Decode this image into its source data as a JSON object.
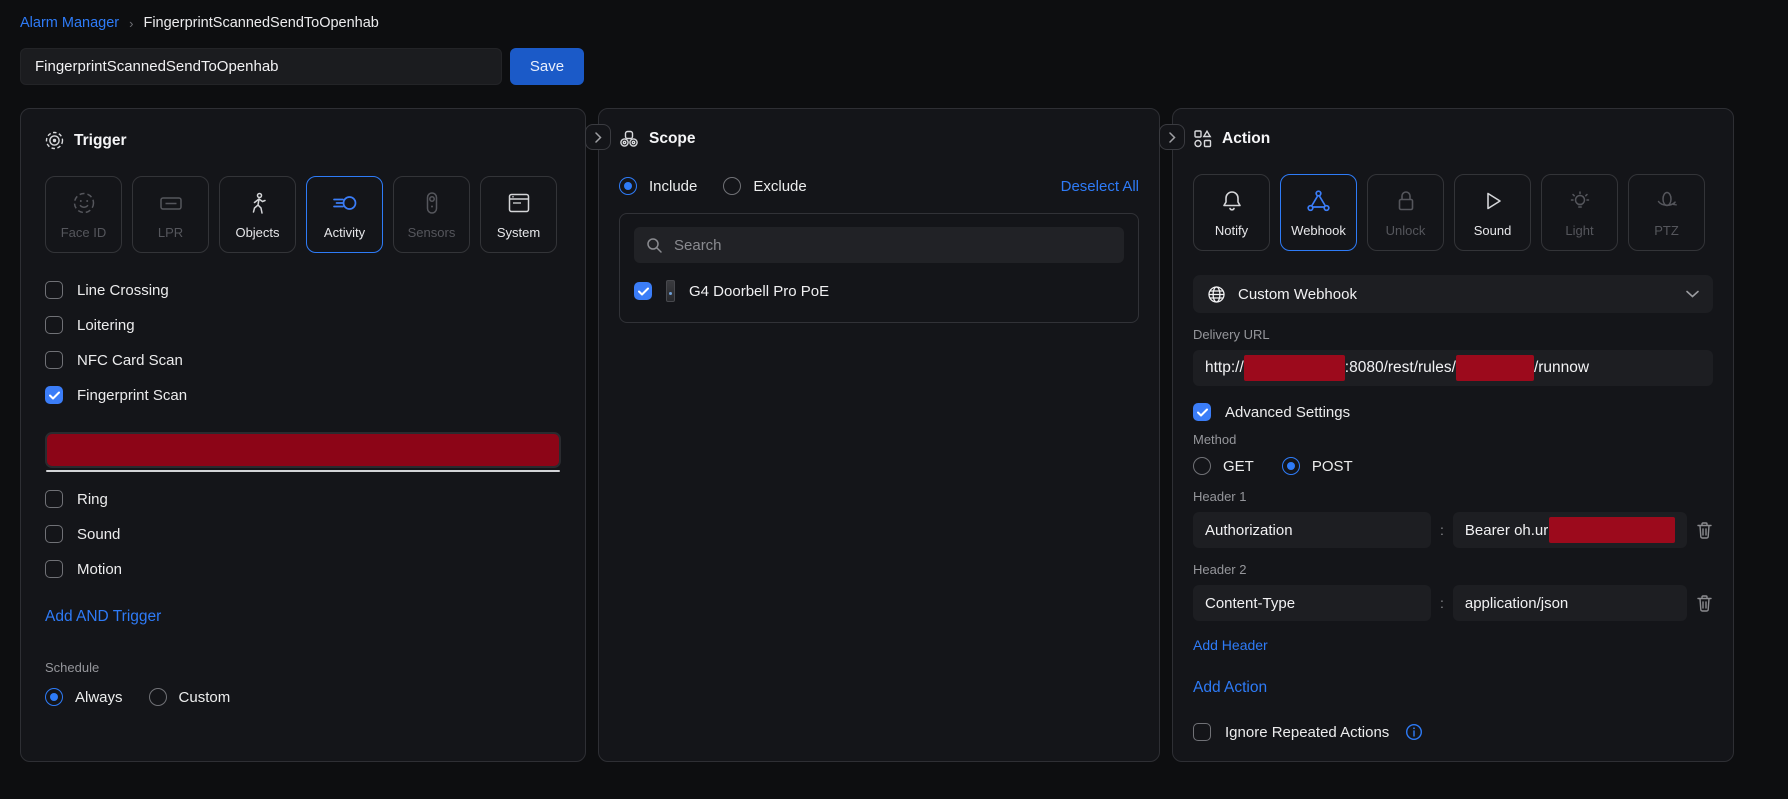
{
  "breadcrumb": {
    "parent": "Alarm Manager",
    "divider": "›",
    "current": "FingerprintScannedSendToOpenhab"
  },
  "name_field": {
    "value": "FingerprintScannedSendToOpenhab"
  },
  "save_label": "Save",
  "colors": {
    "accent_blue": "#2e7bf7",
    "save_button": "#1b5ac8",
    "checkbox_blue": "#3b7df8",
    "redaction_dark_red": "#8c0517",
    "redaction_red": "#9c0a1c",
    "panel_bg": "#141519",
    "page_bg": "#0d0e10"
  },
  "trigger": {
    "title": "Trigger",
    "types": [
      {
        "label": "Face ID",
        "state": "disabled"
      },
      {
        "label": "LPR",
        "state": "disabled"
      },
      {
        "label": "Objects",
        "state": "normal"
      },
      {
        "label": "Activity",
        "state": "selected"
      },
      {
        "label": "Sensors",
        "state": "disabled"
      },
      {
        "label": "System",
        "state": "normal"
      }
    ],
    "events": [
      {
        "label": "Line Crossing",
        "checked": false
      },
      {
        "label": "Loitering",
        "checked": false
      },
      {
        "label": "NFC Card Scan",
        "checked": false
      },
      {
        "label": "Fingerprint Scan",
        "checked": true
      },
      {
        "label": "Ring",
        "checked": false
      },
      {
        "label": "Sound",
        "checked": false
      },
      {
        "label": "Motion",
        "checked": false
      }
    ],
    "add_and_trigger": "Add AND Trigger",
    "schedule_label": "Schedule",
    "schedule_options": [
      {
        "label": "Always",
        "selected": true
      },
      {
        "label": "Custom",
        "selected": false
      }
    ]
  },
  "scope": {
    "title": "Scope",
    "mode_options": [
      {
        "label": "Include",
        "selected": true
      },
      {
        "label": "Exclude",
        "selected": false
      }
    ],
    "deselect_all": "Deselect All",
    "search_placeholder": "Search",
    "devices": [
      {
        "label": "G4 Doorbell Pro PoE",
        "checked": true
      }
    ]
  },
  "action": {
    "title": "Action",
    "types": [
      {
        "label": "Notify",
        "state": "normal"
      },
      {
        "label": "Webhook",
        "state": "selected"
      },
      {
        "label": "Unlock",
        "state": "disabled"
      },
      {
        "label": "Sound",
        "state": "normal"
      },
      {
        "label": "Light",
        "state": "disabled"
      },
      {
        "label": "PTZ",
        "state": "disabled"
      }
    ],
    "webhook_select": "Custom Webhook",
    "delivery_url_label": "Delivery URL",
    "delivery_url": {
      "prefix": "http://",
      "mid": ":8080/rest/rules/",
      "suffix": "/runnow"
    },
    "advanced_settings": "Advanced Settings",
    "method_label": "Method",
    "method_options": [
      {
        "label": "GET",
        "selected": false
      },
      {
        "label": "POST",
        "selected": true
      }
    ],
    "separator": ":",
    "headers": [
      {
        "label": "Header 1",
        "key": "Authorization",
        "value": "Bearer oh.ur",
        "value_redacted": true
      },
      {
        "label": "Header 2",
        "key": "Content-Type",
        "value": "application/json",
        "value_redacted": false
      }
    ],
    "add_header": "Add Header",
    "add_action": "Add Action",
    "ignore_repeated": "Ignore Repeated Actions"
  }
}
